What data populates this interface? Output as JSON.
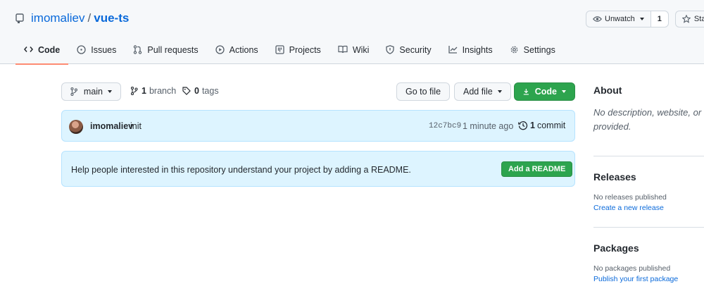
{
  "repo": {
    "owner": "imomaliev",
    "separator": "/",
    "name": "vue-ts"
  },
  "actions": {
    "watch_label": "Unwatch",
    "watch_count": "1",
    "star_label": "Sta"
  },
  "tabs": [
    {
      "label": "Code",
      "icon": "code-icon",
      "active": true
    },
    {
      "label": "Issues",
      "icon": "issue-icon"
    },
    {
      "label": "Pull requests",
      "icon": "pull-request-icon"
    },
    {
      "label": "Actions",
      "icon": "play-icon"
    },
    {
      "label": "Projects",
      "icon": "project-icon"
    },
    {
      "label": "Wiki",
      "icon": "book-icon"
    },
    {
      "label": "Security",
      "icon": "shield-icon"
    },
    {
      "label": "Insights",
      "icon": "graph-icon"
    },
    {
      "label": "Settings",
      "icon": "gear-icon"
    }
  ],
  "toolbar": {
    "branch_select": "main",
    "branch_count": "1",
    "branch_label": "branch",
    "tag_count": "0",
    "tag_label": "tags",
    "go_to_file": "Go to file",
    "add_file": "Add file",
    "code_button": "Code"
  },
  "commit": {
    "author": "imomaliev",
    "message": "init",
    "sha": "12c7bc9",
    "time": "1 minute ago",
    "count": "1",
    "count_label": "commit"
  },
  "readme_prompt": {
    "text": "Help people interested in this repository understand your project by adding a README.",
    "button": "Add a README"
  },
  "sidebar": {
    "about_heading": "About",
    "about_description": "No description, website, or\nprovided.",
    "releases_heading": "Releases",
    "releases_empty": "No releases published",
    "releases_link": "Create a new release",
    "packages_heading": "Packages",
    "packages_empty": "No packages published",
    "packages_link": "Publish your first package"
  },
  "colors": {
    "accent": "#0969da",
    "primary": "#2da44e",
    "tab_underline": "#fd8c73",
    "notice_bg": "#ddf4ff"
  }
}
